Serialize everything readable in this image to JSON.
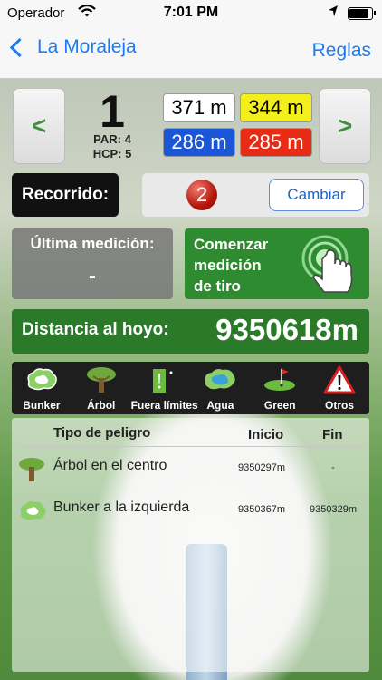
{
  "status_bar": {
    "carrier": "Operador",
    "time": "7:01 PM",
    "battery_level": 0.95
  },
  "nav": {
    "back_label": "La Moraleja",
    "right_label": "Reglas"
  },
  "hole": {
    "prev_label": "<",
    "next_label": ">",
    "number": "1",
    "par": "PAR: 4",
    "hcp": "HCP: 5",
    "distances": {
      "white": "371 m",
      "yellow": "344 m",
      "blue": "286 m",
      "red": "285 m"
    }
  },
  "route": {
    "label": "Recorrido:",
    "number": "2",
    "change_label": "Cambiar"
  },
  "measurement": {
    "last_label": "Última medición:",
    "last_value": "-",
    "start_label_1": "Comenzar",
    "start_label_2": "medición",
    "start_label_3": "de tiro"
  },
  "distance": {
    "label": "Distancia al hoyo:",
    "value": "9350618m"
  },
  "hazards": [
    {
      "label": "Bunker",
      "icon": "bunker-icon"
    },
    {
      "label": "Árbol",
      "icon": "tree-icon"
    },
    {
      "label": "Fuera límites",
      "icon": "out-of-bounds-icon"
    },
    {
      "label": "Agua",
      "icon": "water-icon"
    },
    {
      "label": "Green",
      "icon": "green-flag-icon"
    },
    {
      "label": "Otros",
      "icon": "warning-icon"
    }
  ],
  "table": {
    "headers": {
      "type": "Tipo de peligro",
      "start": "Inicio",
      "end": "Fin"
    },
    "rows": [
      {
        "icon": "tree-icon",
        "name": "Árbol en el centro",
        "start": "9350297m",
        "end": "-"
      },
      {
        "icon": "bunker-icon",
        "name": "Bunker a la izquierda",
        "start": "9350367m",
        "end": "9350329m"
      }
    ]
  },
  "colors": {
    "accent_blue": "#1a7cf5",
    "green_button": "#2f8b30",
    "distance_bar": "#2b7a2a"
  }
}
